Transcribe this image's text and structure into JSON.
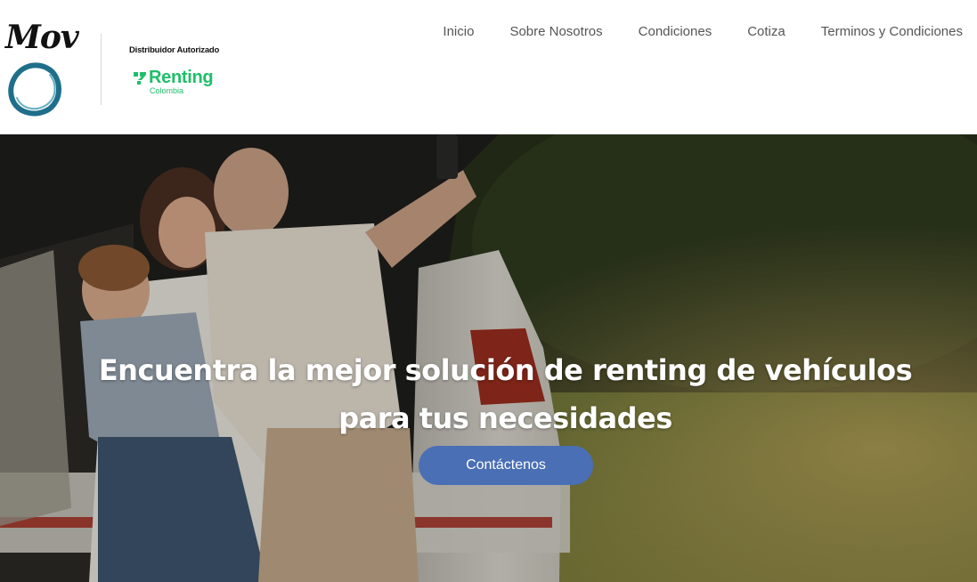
{
  "brand": {
    "logo_text": "Mov",
    "distributor_label": "Distribuidor Autorizado",
    "partner_name": "Renting",
    "partner_sub": "Colombia",
    "partner_color": "#1fbf6a",
    "ring_color": "#1f6f8b"
  },
  "nav": {
    "items": [
      {
        "label": "Inicio"
      },
      {
        "label": "Sobre Nosotros"
      },
      {
        "label": "Condiciones"
      },
      {
        "label": "Cotiza"
      },
      {
        "label": "Terminos y Condiciones"
      }
    ]
  },
  "hero": {
    "headline_line1": "Encuentra la mejor solución de renting de vehículos",
    "headline_line2": "para tus necesidades",
    "cta_label": "Contáctenos",
    "cta_color": "#4a6fb5"
  }
}
